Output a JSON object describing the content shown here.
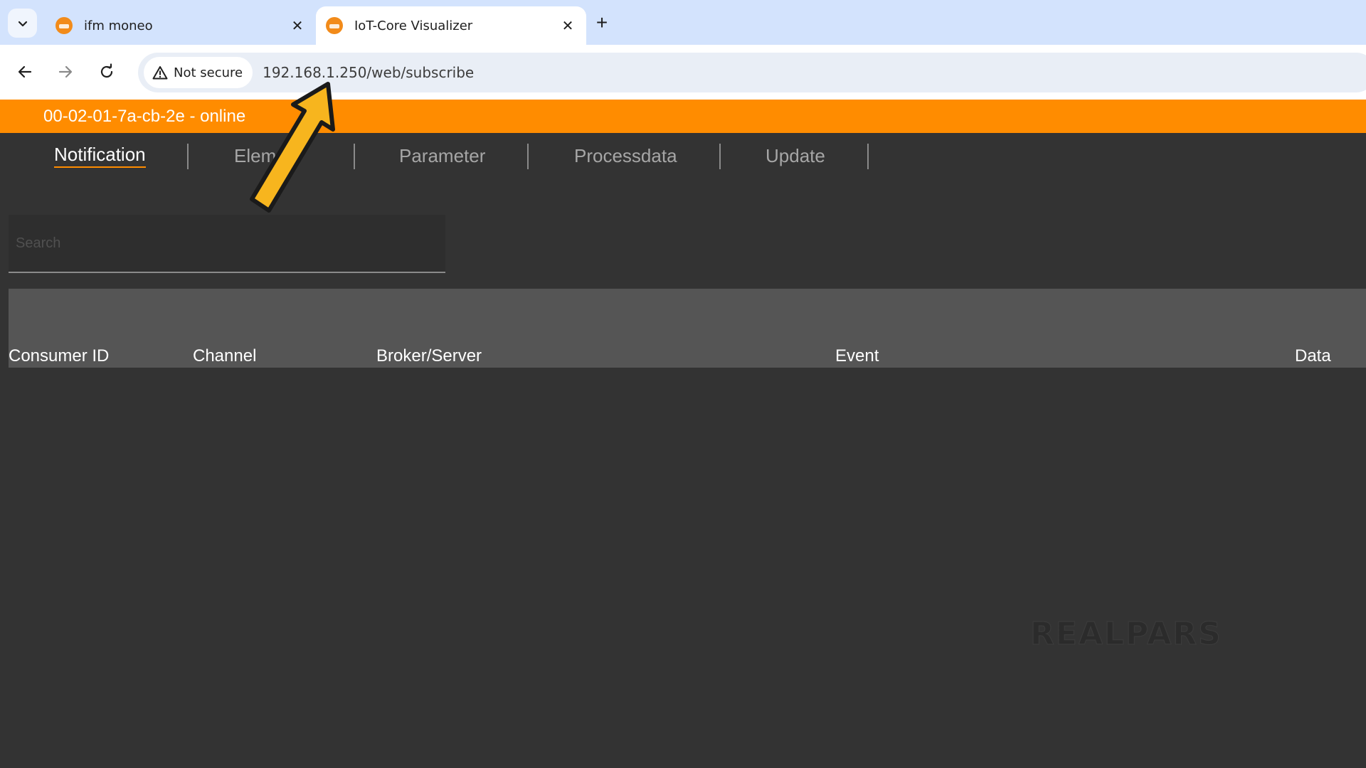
{
  "browser": {
    "tabs": [
      {
        "title": "ifm moneo",
        "active": false
      },
      {
        "title": "IoT-Core Visualizer",
        "active": true
      }
    ],
    "address": {
      "security_label": "Not secure",
      "url": "192.168.1.250/web/subscribe"
    }
  },
  "status": {
    "text": "00-02-01-7a-cb-2e - online",
    "color": "#ff8c00"
  },
  "nav": {
    "tabs": [
      {
        "label": "Notification",
        "active": true
      },
      {
        "label": "Elem",
        "active": false
      },
      {
        "label": "Parameter",
        "active": false
      },
      {
        "label": "Processdata",
        "active": false
      },
      {
        "label": "Update",
        "active": false
      }
    ]
  },
  "search": {
    "placeholder": "Search"
  },
  "table": {
    "columns": [
      "Consumer ID",
      "Channel",
      "Broker/Server",
      "Event",
      "Data"
    ]
  },
  "watermark": {
    "text": "REALPARS"
  },
  "colors": {
    "accent": "#ff8c00",
    "background": "#333333",
    "header": "#555555"
  }
}
